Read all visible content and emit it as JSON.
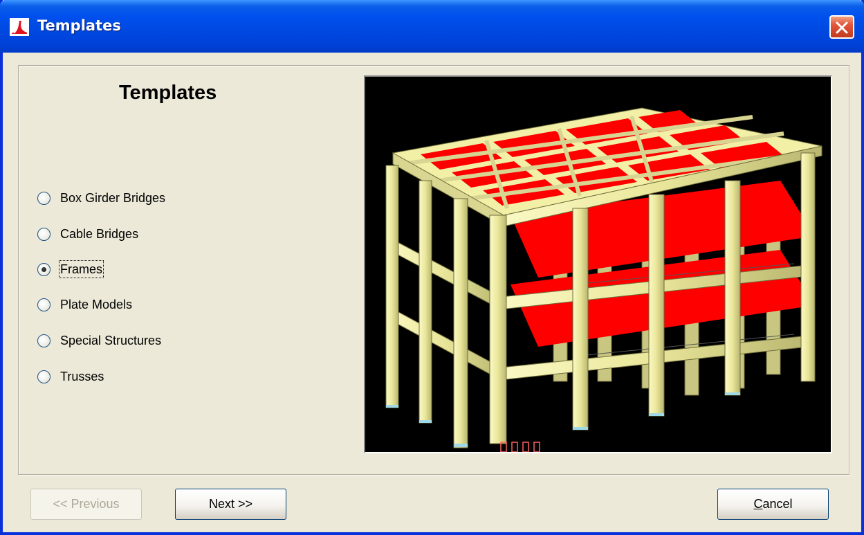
{
  "window": {
    "title": "Templates",
    "colors": {
      "titlebar": "#0050ee",
      "close": "#e2553a",
      "face": "#ece9d8"
    }
  },
  "panel": {
    "heading": "Templates",
    "options": [
      {
        "label": "Box Girder Bridges",
        "selected": false
      },
      {
        "label": "Cable Bridges",
        "selected": false
      },
      {
        "label": "Frames",
        "selected": true
      },
      {
        "label": "Plate Models",
        "selected": false
      },
      {
        "label": "Special Structures",
        "selected": false
      },
      {
        "label": "Trusses",
        "selected": false
      }
    ]
  },
  "preview": {
    "description": "3D rendered frame structure preview",
    "colors": {
      "background": "#000000",
      "members": "#f2f0a6",
      "slabs": "#ff0000"
    }
  },
  "buttons": {
    "previous": "<< Previous",
    "next": "Next >>",
    "cancel_u": "C",
    "cancel_rest": "ancel"
  }
}
